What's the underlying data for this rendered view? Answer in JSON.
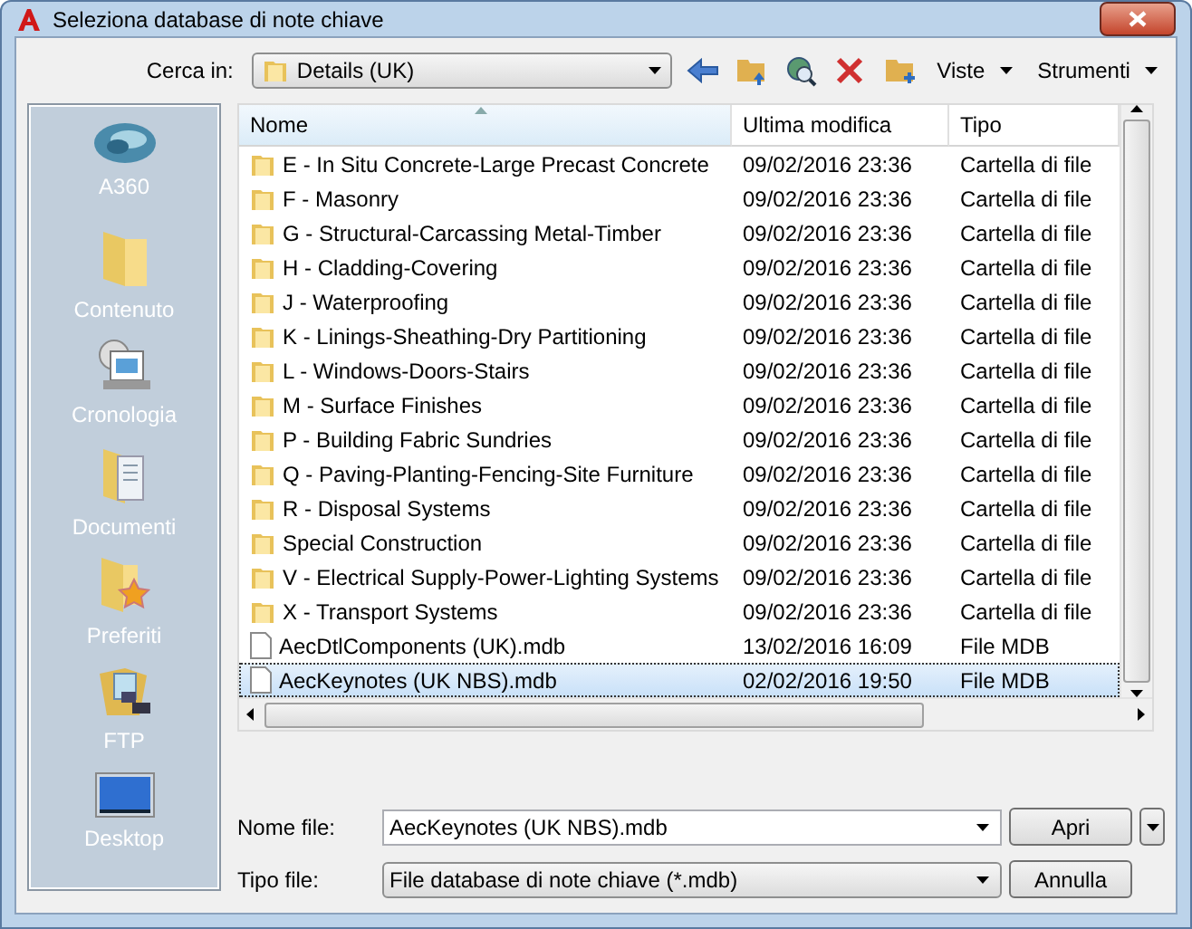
{
  "window": {
    "title": "Seleziona database di note chiave"
  },
  "look_in": {
    "label": "Cerca in:",
    "value": "Details (UK)"
  },
  "toolbar": [
    {
      "kind": "back"
    },
    {
      "kind": "up"
    },
    {
      "kind": "web"
    },
    {
      "kind": "delete"
    },
    {
      "kind": "newfolder"
    },
    {
      "kind": "menu",
      "label": "Viste"
    },
    {
      "kind": "menu",
      "label": "Strumenti"
    }
  ],
  "places": [
    {
      "kind": "cloud",
      "label": "A360"
    },
    {
      "kind": "folder",
      "label": "Contenuto"
    },
    {
      "kind": "history",
      "label": "Cronologia"
    },
    {
      "kind": "docs",
      "label": "Documenti"
    },
    {
      "kind": "star",
      "label": "Preferiti"
    },
    {
      "kind": "ftp",
      "label": "FTP"
    },
    {
      "kind": "desktop",
      "label": "Desktop"
    }
  ],
  "table": {
    "columns": [
      "Nome",
      "Ultima modifica",
      "Tipo"
    ],
    "rows": [
      {
        "kind": "folder",
        "name": "E - In Situ Concrete-Large Precast Concrete",
        "modified": "09/02/2016 23:36",
        "type": "Cartella di file",
        "selected": false
      },
      {
        "kind": "folder",
        "name": "F - Masonry",
        "modified": "09/02/2016 23:36",
        "type": "Cartella di file",
        "selected": false
      },
      {
        "kind": "folder",
        "name": "G - Structural-Carcassing Metal-Timber",
        "modified": "09/02/2016 23:36",
        "type": "Cartella di file",
        "selected": false
      },
      {
        "kind": "folder",
        "name": "H - Cladding-Covering",
        "modified": "09/02/2016 23:36",
        "type": "Cartella di file",
        "selected": false
      },
      {
        "kind": "folder",
        "name": "J - Waterproofing",
        "modified": "09/02/2016 23:36",
        "type": "Cartella di file",
        "selected": false
      },
      {
        "kind": "folder",
        "name": "K - Linings-Sheathing-Dry Partitioning",
        "modified": "09/02/2016 23:36",
        "type": "Cartella di file",
        "selected": false
      },
      {
        "kind": "folder",
        "name": "L - Windows-Doors-Stairs",
        "modified": "09/02/2016 23:36",
        "type": "Cartella di file",
        "selected": false
      },
      {
        "kind": "folder",
        "name": "M - Surface Finishes",
        "modified": "09/02/2016 23:36",
        "type": "Cartella di file",
        "selected": false
      },
      {
        "kind": "folder",
        "name": "P - Building Fabric Sundries",
        "modified": "09/02/2016 23:36",
        "type": "Cartella di file",
        "selected": false
      },
      {
        "kind": "folder",
        "name": "Q - Paving-Planting-Fencing-Site Furniture",
        "modified": "09/02/2016 23:36",
        "type": "Cartella di file",
        "selected": false
      },
      {
        "kind": "folder",
        "name": "R - Disposal Systems",
        "modified": "09/02/2016 23:36",
        "type": "Cartella di file",
        "selected": false
      },
      {
        "kind": "folder",
        "name": "Special Construction",
        "modified": "09/02/2016 23:36",
        "type": "Cartella di file",
        "selected": false
      },
      {
        "kind": "folder",
        "name": "V - Electrical Supply-Power-Lighting Systems",
        "modified": "09/02/2016 23:36",
        "type": "Cartella di file",
        "selected": false
      },
      {
        "kind": "folder",
        "name": "X - Transport Systems",
        "modified": "09/02/2016 23:36",
        "type": "Cartella di file",
        "selected": false
      },
      {
        "kind": "file",
        "name": "AecDtlComponents (UK).mdb",
        "modified": "13/02/2016 16:09",
        "type": "File MDB",
        "selected": false
      },
      {
        "kind": "file",
        "name": "AecKeynotes (UK NBS).mdb",
        "modified": "02/02/2016 19:50",
        "type": "File MDB",
        "selected": true
      }
    ]
  },
  "file_name": {
    "label": "Nome file:",
    "value": "AecKeynotes (UK NBS).mdb"
  },
  "file_type": {
    "label": "Tipo file:",
    "value": "File database di note chiave (*.mdb)"
  },
  "buttons": [
    "Apri",
    "Annulla"
  ]
}
